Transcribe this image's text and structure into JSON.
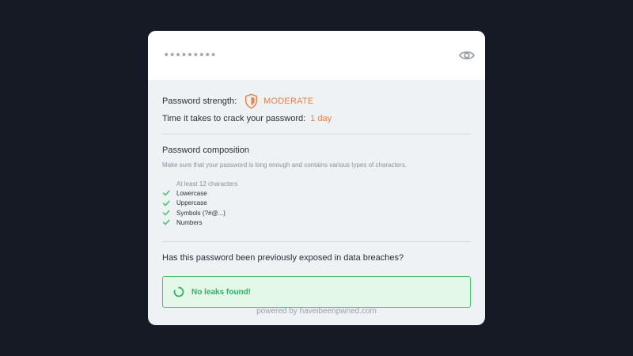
{
  "password": {
    "value": "•••••••••"
  },
  "strength": {
    "label": "Password strength:",
    "value": "MODERATE",
    "color": "#e8834a"
  },
  "crack_time": {
    "label": "Time it takes to crack your password:",
    "value": "1 day"
  },
  "composition": {
    "title": "Password composition",
    "description": "Make sure that your password is long enough and contains various types of characters.",
    "requirements": [
      {
        "label": "At least 12 characters",
        "met": false
      },
      {
        "label": "Lowercase",
        "met": true
      },
      {
        "label": "Uppercase",
        "met": true
      },
      {
        "label": "Symbols (?#@...)",
        "met": true
      },
      {
        "label": "Numbers",
        "met": true
      }
    ]
  },
  "breach": {
    "question": "Has this password been previously exposed in data breaches?",
    "result": "No leaks found!",
    "result_color": "#2fb463"
  },
  "footer": {
    "powered_by": "powered by haveibeenpwned.com"
  },
  "icons": {
    "visibility_toggle": "eye-icon",
    "strength": "shield-icon",
    "requirement_met": "check-icon",
    "result_status": "spinner-icon"
  }
}
